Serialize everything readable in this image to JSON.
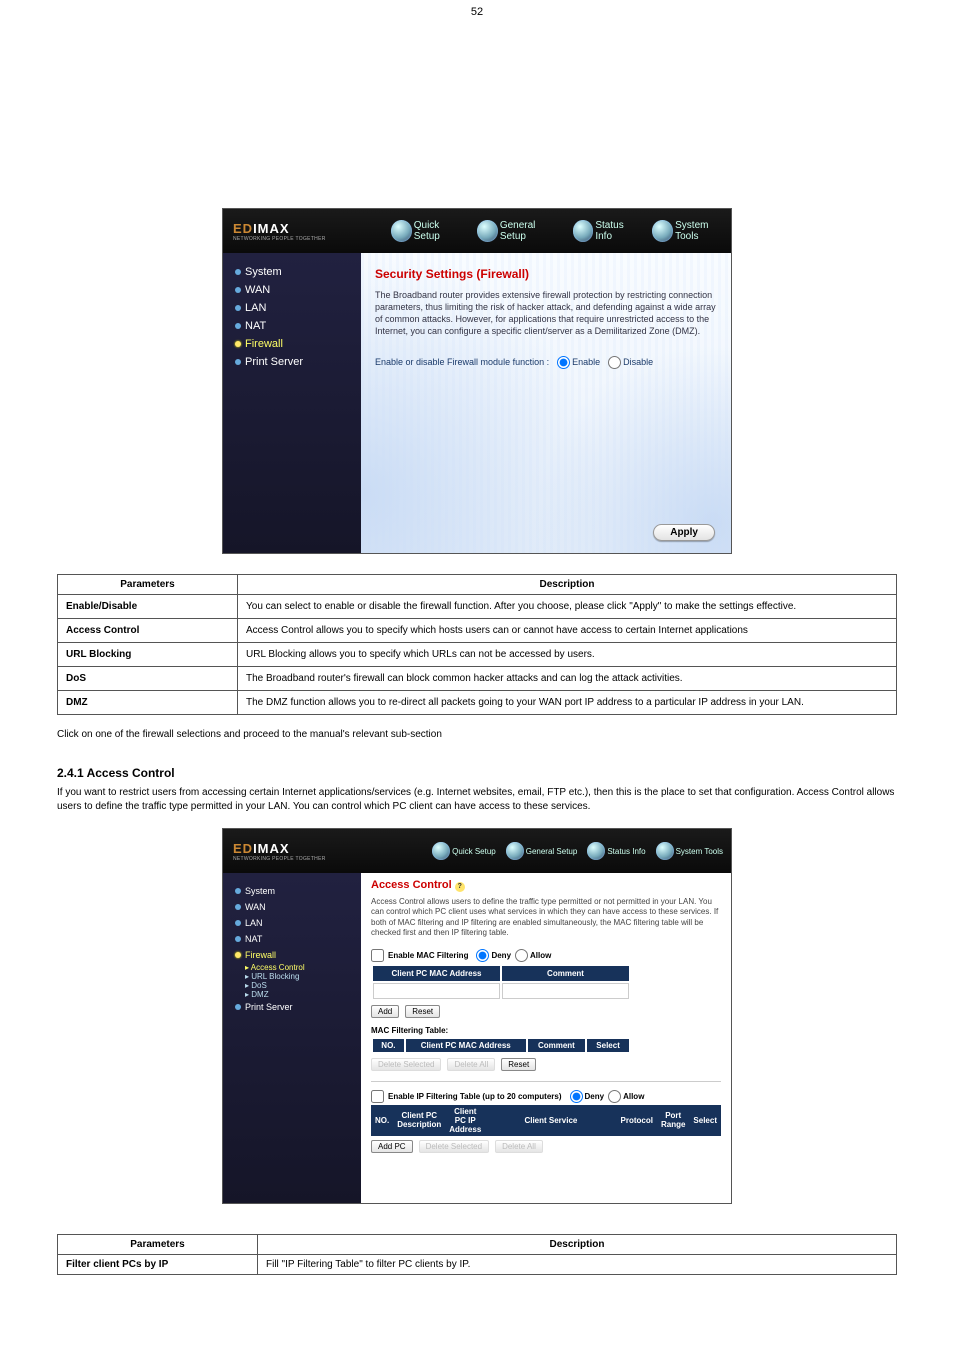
{
  "page_number": "52",
  "brand": {
    "word": "EDIMAX",
    "tagline": "NETWORKING PEOPLE TOGETHER"
  },
  "tabs": {
    "quick": "Quick Setup",
    "general": "General Setup",
    "status": "Status Info",
    "tools": "System Tools"
  },
  "sidebar1": {
    "system": "System",
    "wan": "WAN",
    "lan": "LAN",
    "nat": "NAT",
    "firewall": "Firewall",
    "print": "Print Server"
  },
  "sidebar2": {
    "system": "System",
    "wan": "WAN",
    "lan": "LAN",
    "nat": "NAT",
    "firewall": "Firewall",
    "access": "Access Control",
    "url": "URL Blocking",
    "dos": "DoS",
    "dmz": "DMZ",
    "print": "Print Server"
  },
  "sec1": {
    "title": "Security Settings (Firewall)",
    "desc": "The Broadband router provides extensive firewall protection by restricting connection parameters, thus limiting the risk of hacker attack, and defending against a wide array of common attacks. However, for applications that require unrestricted access to the Internet, you can configure a specific client/server as a Demilitarized Zone (DMZ).",
    "enable_label": "Enable or disable Firewall module function :",
    "enable": "Enable",
    "disable": "Disable",
    "apply": "Apply"
  },
  "ptable1": {
    "h1": "Parameters",
    "h2": "Description",
    "r1a": "Enable/Disable",
    "r1b": "You can select to enable or disable the firewall function. After you choose, please click \"Apply\" to make the settings effective.",
    "r2a": "Access Control",
    "r2b": "Access Control allows you to specify which hosts users can or cannot have access to certain Internet applications",
    "r3a": "URL Blocking",
    "r3b": "URL Blocking allows you to specify which URLs can not be accessed by users.",
    "r4a": "DoS",
    "r4b": "The Broadband router's firewall can block common hacker attacks and can log the attack activities.",
    "r5a": "DMZ",
    "r5b": "The DMZ function allows you to re-direct all packets going to your WAN port IP address to a particular IP address in your LAN."
  },
  "intro": "Click on one of the firewall selections and proceed to the manual's relevant sub-section",
  "h241": "2.4.1 Access Control",
  "para": "If you want to restrict users from accessing certain Internet applications/services (e.g. Internet websites, email, FTP etc.), then this is the place to set that configuration. Access Control allows users to define the traffic type permitted in your LAN. You can control which PC client can have access to these services.",
  "sec2": {
    "title": "Access Control",
    "hint": "?",
    "desc": "Access Control allows users to define the traffic type permitted or not permitted in your LAN. You can control which PC client uses what services in which they can have access to these services.\nIf both of MAC filtering and IP filtering are enabled simultaneously, the MAC filtering table will be checked first and then IP filtering table.",
    "mac_chk": "Enable MAC Filtering",
    "deny": "Deny",
    "allow": "Allow",
    "th_mac": "Client PC MAC Address",
    "th_comment": "Comment",
    "add": "Add",
    "reset": "Reset",
    "mft_title": "MAC Filtering Table:",
    "th_no": "NO.",
    "th_select": "Select",
    "del_sel": "Delete Selected",
    "del_all": "Delete All",
    "ip_chk": "Enable IP Filtering Table (up to 20 computers)",
    "th_cpc_desc": "Client PC Description",
    "th_cpc_ip": "Client PC IP Address",
    "th_cservice": "Client Service",
    "th_proto": "Protocol",
    "th_port": "Port Range",
    "add_pc": "Add PC"
  },
  "ptable2": {
    "h1": "Parameters",
    "h2": "Description",
    "r1a": "Filter client PCs by IP",
    "r1b": "Fill \"IP Filtering Table\" to filter PC clients by IP."
  }
}
